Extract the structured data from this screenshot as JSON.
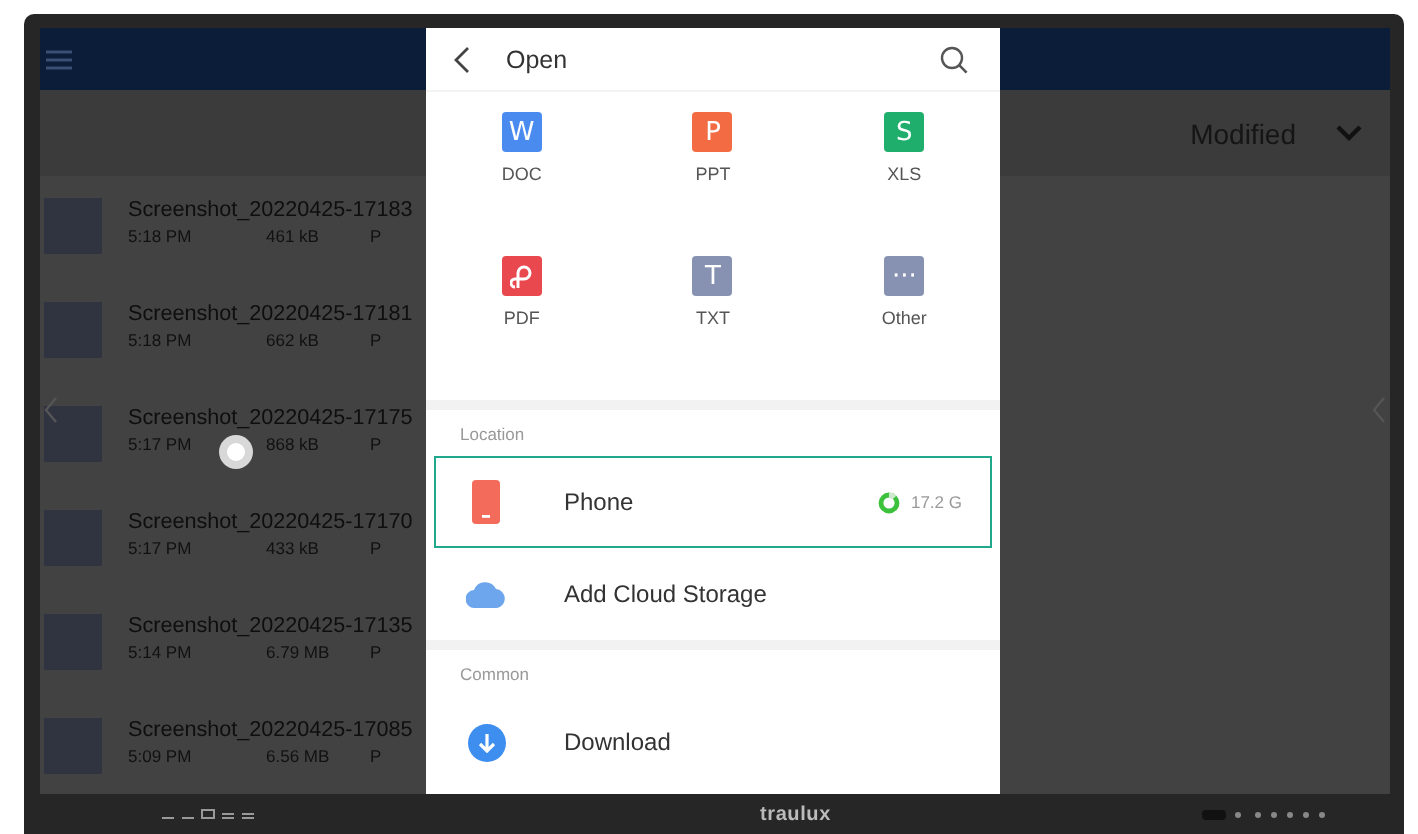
{
  "sort_bar": {
    "label": "Modified"
  },
  "files": [
    {
      "name": "Screenshot_20220425-17183",
      "time": "5:18 PM",
      "size": "461 kB",
      "type": "P"
    },
    {
      "name": "Screenshot_20220425-17181",
      "time": "5:18 PM",
      "size": "662 kB",
      "type": "P"
    },
    {
      "name": "Screenshot_20220425-17175",
      "time": "5:17 PM",
      "size": "868 kB",
      "type": "P"
    },
    {
      "name": "Screenshot_20220425-17170",
      "time": "5:17 PM",
      "size": "433 kB",
      "type": "P"
    },
    {
      "name": "Screenshot_20220425-17135",
      "time": "5:14 PM",
      "size": "6.79 MB",
      "type": "P"
    },
    {
      "name": "Screenshot_20220425-17085",
      "time": "5:09 PM",
      "size": "6.56 MB",
      "type": "P"
    }
  ],
  "dialog": {
    "title": "Open",
    "file_types": [
      {
        "label": "DOC",
        "kind": "doc",
        "glyph": "W",
        "color": "#4a8bf0"
      },
      {
        "label": "PPT",
        "kind": "ppt",
        "glyph": "P",
        "color": "#f26b43"
      },
      {
        "label": "XLS",
        "kind": "xls",
        "glyph": "S",
        "color": "#1fae6c"
      },
      {
        "label": "PDF",
        "kind": "pdf",
        "color": "#e9484f"
      },
      {
        "label": "TXT",
        "kind": "txt",
        "glyph": "T",
        "color": "#8792b3"
      },
      {
        "label": "Other",
        "kind": "other",
        "glyph": "···",
        "color": "#8792b3"
      }
    ],
    "sections": [
      {
        "label": "Location",
        "items": [
          {
            "label": "Phone",
            "kind": "phone",
            "selected": true,
            "storage": "17.2 G"
          },
          {
            "label": "Add Cloud Storage",
            "kind": "cloud",
            "selected": false
          }
        ]
      },
      {
        "label": "Common",
        "items": [
          {
            "label": "Download",
            "kind": "download",
            "selected": false
          }
        ]
      }
    ]
  },
  "bezel": {
    "logo": "traulux"
  }
}
